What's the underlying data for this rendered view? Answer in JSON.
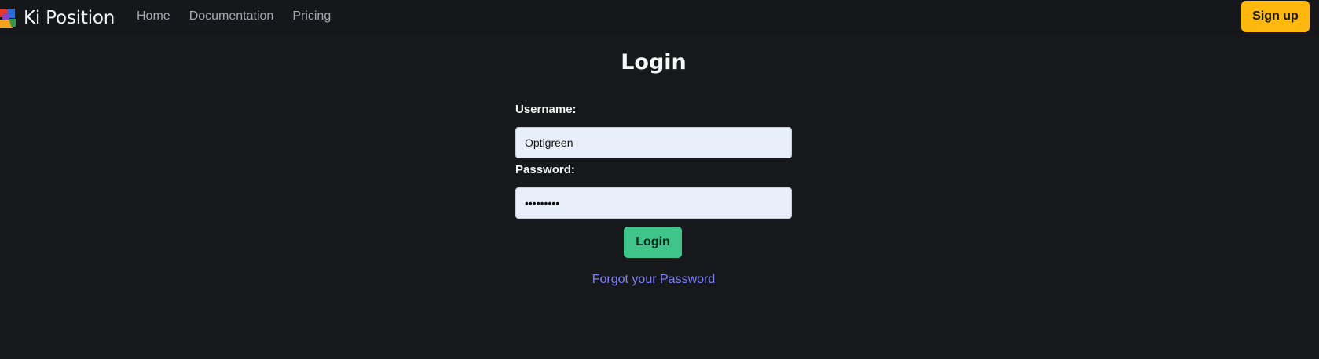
{
  "brand": {
    "name": "Ki Position"
  },
  "nav": {
    "links": [
      {
        "label": "Home"
      },
      {
        "label": "Documentation"
      },
      {
        "label": "Pricing"
      }
    ],
    "signup_label": "Sign up"
  },
  "login": {
    "title": "Login",
    "username_label": "Username:",
    "username_value": "Optigreen",
    "password_label": "Password:",
    "password_value": "•••••••••",
    "submit_label": "Login",
    "forgot_label": "Forgot your Password"
  },
  "colors": {
    "background": "#17181b",
    "accent_signup": "#ffb80e",
    "accent_login": "#3fc48a",
    "link": "#7c7ff6",
    "input_bg": "#e8effb"
  },
  "icons": {
    "logo": "ki-position-logo-icon"
  }
}
